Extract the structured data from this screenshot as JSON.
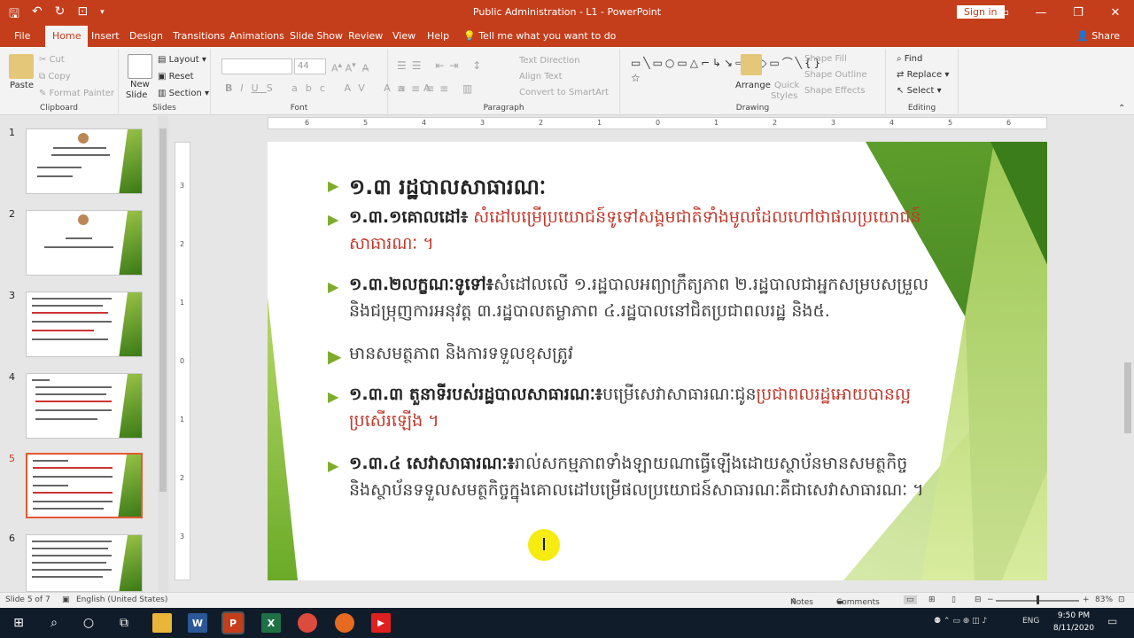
{
  "window": {
    "title": "Public Administration - L1  -  PowerPoint",
    "signin": "Sign in",
    "share": "Share"
  },
  "tabs": [
    "File",
    "Home",
    "Insert",
    "Design",
    "Transitions",
    "Animations",
    "Slide Show",
    "Review",
    "View",
    "Help"
  ],
  "tell_me": "Tell me what you want to do",
  "ribbon": {
    "clipboard": {
      "label": "Clipboard",
      "paste": "Paste",
      "cut": "Cut",
      "copy": "Copy",
      "format_painter": "Format Painter"
    },
    "slides": {
      "label": "Slides",
      "new_slide": "New",
      "new_slide2": "Slide",
      "layout": "Layout",
      "reset": "Reset",
      "section": "Section"
    },
    "font": {
      "label": "Font",
      "size": "44"
    },
    "paragraph": {
      "label": "Paragraph",
      "text_direction": "Text Direction",
      "align_text": "Align Text",
      "convert_smartart": "Convert to SmartArt"
    },
    "drawing": {
      "label": "Drawing",
      "arrange": "Arrange",
      "quick_styles": "Quick",
      "quick_styles2": "Styles",
      "shape_fill": "Shape Fill",
      "shape_outline": "Shape Outline",
      "shape_effects": "Shape Effects"
    },
    "editing": {
      "label": "Editing",
      "find": "Find",
      "replace": "Replace",
      "select": "Select"
    }
  },
  "thumbnails": {
    "numbers": [
      "1",
      "2",
      "3",
      "4",
      "5",
      "6"
    ],
    "selected": "5"
  },
  "ruler": {
    "h": [
      "6",
      "5",
      "4",
      "3",
      "2",
      "1",
      "0",
      "1",
      "2",
      "3",
      "4",
      "5",
      "6"
    ],
    "v": [
      "3",
      "2",
      "1",
      "0",
      "1",
      "2",
      "3"
    ]
  },
  "slide": {
    "p1": {
      "head": "១.៣ រដ្ឋបាលសាធារណៈ"
    },
    "p2": {
      "head": "១.៣.១គោលដៅ៖",
      "red": " សំដៅបម្រើប្រយោជន៍ទូទៅសង្គមជាតិទាំងមូលដែលហៅថាផលប្រយោជន៍សាធារណៈ ។"
    },
    "p3": {
      "head": "១.៣.២លក្ខណៈទូទៅ៖",
      "body": "សំដៅលលើ ១.រដ្ឋបាលអព្យាក្រឹត្យភាព ២.រដ្ឋបាលជាអ្នកសម្របសម្រួល និងជម្រុញការអនុវត្ត ៣.រដ្ឋបាលតម្លាភាព ៤.រដ្ឋបាលនៅជិតប្រជាពលរដ្ឋ និង៥."
    },
    "p4": {
      "body": "មានសមត្ថភាព និងការទទួលខុសត្រូវ"
    },
    "p5": {
      "head": "១.៣.៣ តួនាទីរបស់រដ្ឋបាលសាធារណៈ៖",
      "body": "បម្រើសេវាសាធារណៈជូន",
      "red": "ប្រជាពលរដ្ឋអោយបានល្អប្រសើរឡើង ។"
    },
    "p6": {
      "head": "១.៣.៤ សេវាសាធារណៈ៖",
      "body": "រាល់សកម្មភាពទាំងឡាយណាធ្វើឡើងដោយស្ថាប័នមានសមត្ថកិច្ច និងស្ថាប័នទទួលសមត្ថកិច្ចក្នុងគោលដៅបម្រើផលប្រយោជន៍សាធារណៈគឺជាសេវាសាធារណៈ ។"
    }
  },
  "status": {
    "slide": "Slide 5 of 7",
    "lang": "English (United States)",
    "notes": "Notes",
    "comments": "Comments",
    "zoom": "83%"
  },
  "tray": {
    "lang": "ENG",
    "time": "9:50 PM",
    "date": "8/11/2020"
  }
}
